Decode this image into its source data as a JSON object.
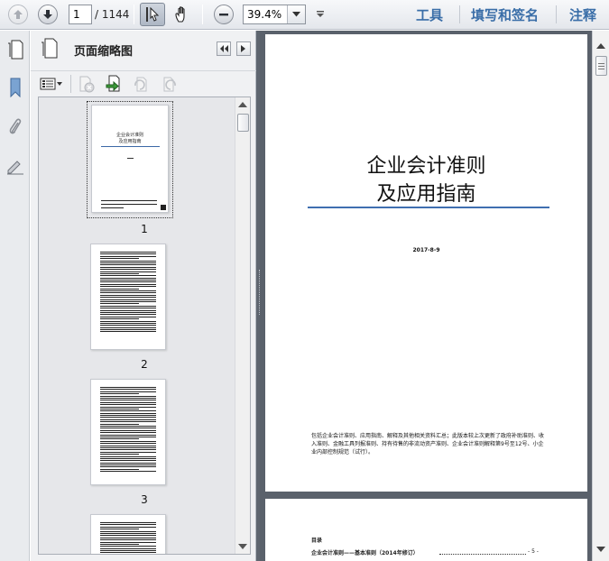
{
  "toolbar": {
    "current_page": "1",
    "page_total": "/ 1144",
    "zoom_value": "39.4%",
    "tools_label": "工具",
    "fill_sign_label": "填写和签名",
    "comment_label": "注释"
  },
  "icons": {
    "prev_page": "arrow-up-icon",
    "next_page": "arrow-down-icon",
    "select_tool": "cursor-icon",
    "hand_tool": "hand-icon",
    "zoom_out": "minus-icon",
    "expand": "chevron-down-icon"
  },
  "panel": {
    "title": "页面缩略图",
    "thumbnails": [
      {
        "label": "1"
      },
      {
        "label": "2"
      },
      {
        "label": "3"
      }
    ]
  },
  "page1": {
    "title_line1": "企业会计准则",
    "title_line2": "及应用指南",
    "date": "2017-8-9",
    "description": "包括企业会计准则、应用指南、解释及其他相关资料汇总；此版本较上次更新了政府补助准则、收入准则、金融工具列报准则、持有待售的非流动资产准则、企业会计准则解释第9号至12号、小企业内部控制规范（试行）。"
  },
  "page2": {
    "toc_heading": "目录",
    "toc_entry": "企业会计准则——基本准则（2014年修订）",
    "toc_page": "- 5 -"
  },
  "thumb1": {
    "title_line1": "企业会计准则",
    "title_line2": "及应用指南"
  }
}
